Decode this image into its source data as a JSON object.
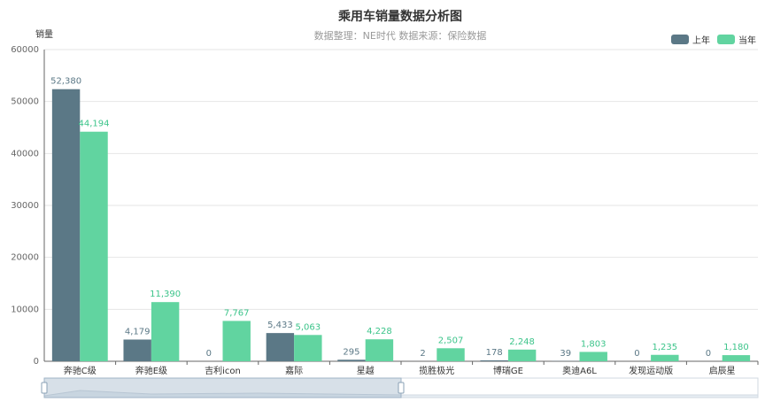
{
  "chart_data": {
    "type": "bar",
    "title": "乘用车销量数据分析图",
    "subtitle": "数据整理：NE时代 数据来源：保险数据",
    "ylabel": "销量",
    "xlabel": "",
    "ylim": [
      0,
      60000
    ],
    "yticks": [
      "0",
      "10000",
      "20000",
      "30000",
      "40000",
      "50000",
      "60000"
    ],
    "categories": [
      "奔驰C级",
      "奔驰E级",
      "吉利icon",
      "嘉际",
      "星越",
      "揽胜极光",
      "博瑞GE",
      "奥迪A6L",
      "发现运动版",
      "启辰星"
    ],
    "series": [
      {
        "name": "上年",
        "values": [
          52380,
          4179,
          0,
          5433,
          295,
          2,
          178,
          39,
          0,
          0
        ],
        "labels": [
          "52,380",
          "4,179",
          "0",
          "5,433",
          "295",
          "2",
          "178",
          "39",
          "0",
          "0"
        ]
      },
      {
        "name": "当年",
        "values": [
          44194,
          11390,
          7767,
          5063,
          4228,
          2507,
          2248,
          1803,
          1235,
          1180
        ],
        "labels": [
          "44,194",
          "11,390",
          "7,767",
          "5,063",
          "4,228",
          "2,507",
          "2,248",
          "1,803",
          "1,235",
          "1,180"
        ]
      }
    ],
    "legend_position": "top-right",
    "grid": true
  },
  "colors": {
    "prev": "#5b7886",
    "curr": "#61d4a0",
    "label_prev": "#5b7886",
    "label_curr": "#3cc48a"
  },
  "datazoom": {
    "start": 0,
    "end": 0.5
  }
}
